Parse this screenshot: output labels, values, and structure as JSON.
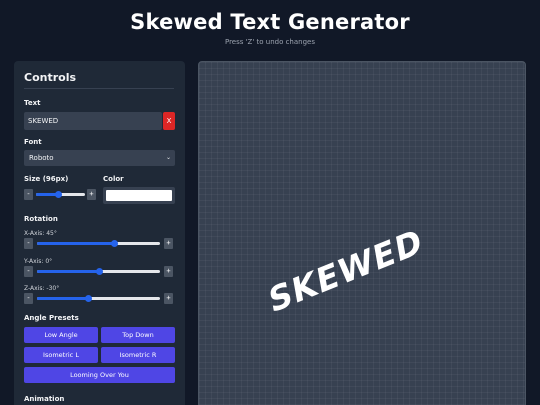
{
  "header": {
    "title": "Skewed Text Generator",
    "subtitle": "Press 'Z' to undo changes"
  },
  "controls": {
    "title": "Controls",
    "text_label": "Text",
    "text_value": "SKEWED",
    "clear_label": "X",
    "font_label": "Font",
    "font_value": "Roboto",
    "size_label": "Size (96px)",
    "size_minus": "-",
    "size_plus": "+",
    "size_level": 0.45,
    "color_label": "Color",
    "color_value": "#ffffff",
    "rotation_label": "Rotation",
    "x_axis_label": "X-Axis: 45°",
    "x_axis_level": 0.625,
    "y_axis_label": "Y-Axis: 0°",
    "y_axis_level": 0.5,
    "z_axis_label": "Z-Axis: -30°",
    "z_axis_level": 0.417,
    "minus": "-",
    "plus": "+",
    "presets_label": "Angle Presets",
    "presets": [
      "Low Angle",
      "Top Down",
      "Isometric L",
      "Isometric R",
      "Looming Over You"
    ],
    "animation_label": "Animation"
  },
  "preview": {
    "text": "SKEWED"
  },
  "colors": {
    "background": "#111827",
    "panel": "#1f2937",
    "accent": "#2563eb",
    "preset": "#4f46e5",
    "danger": "#dc2626"
  }
}
